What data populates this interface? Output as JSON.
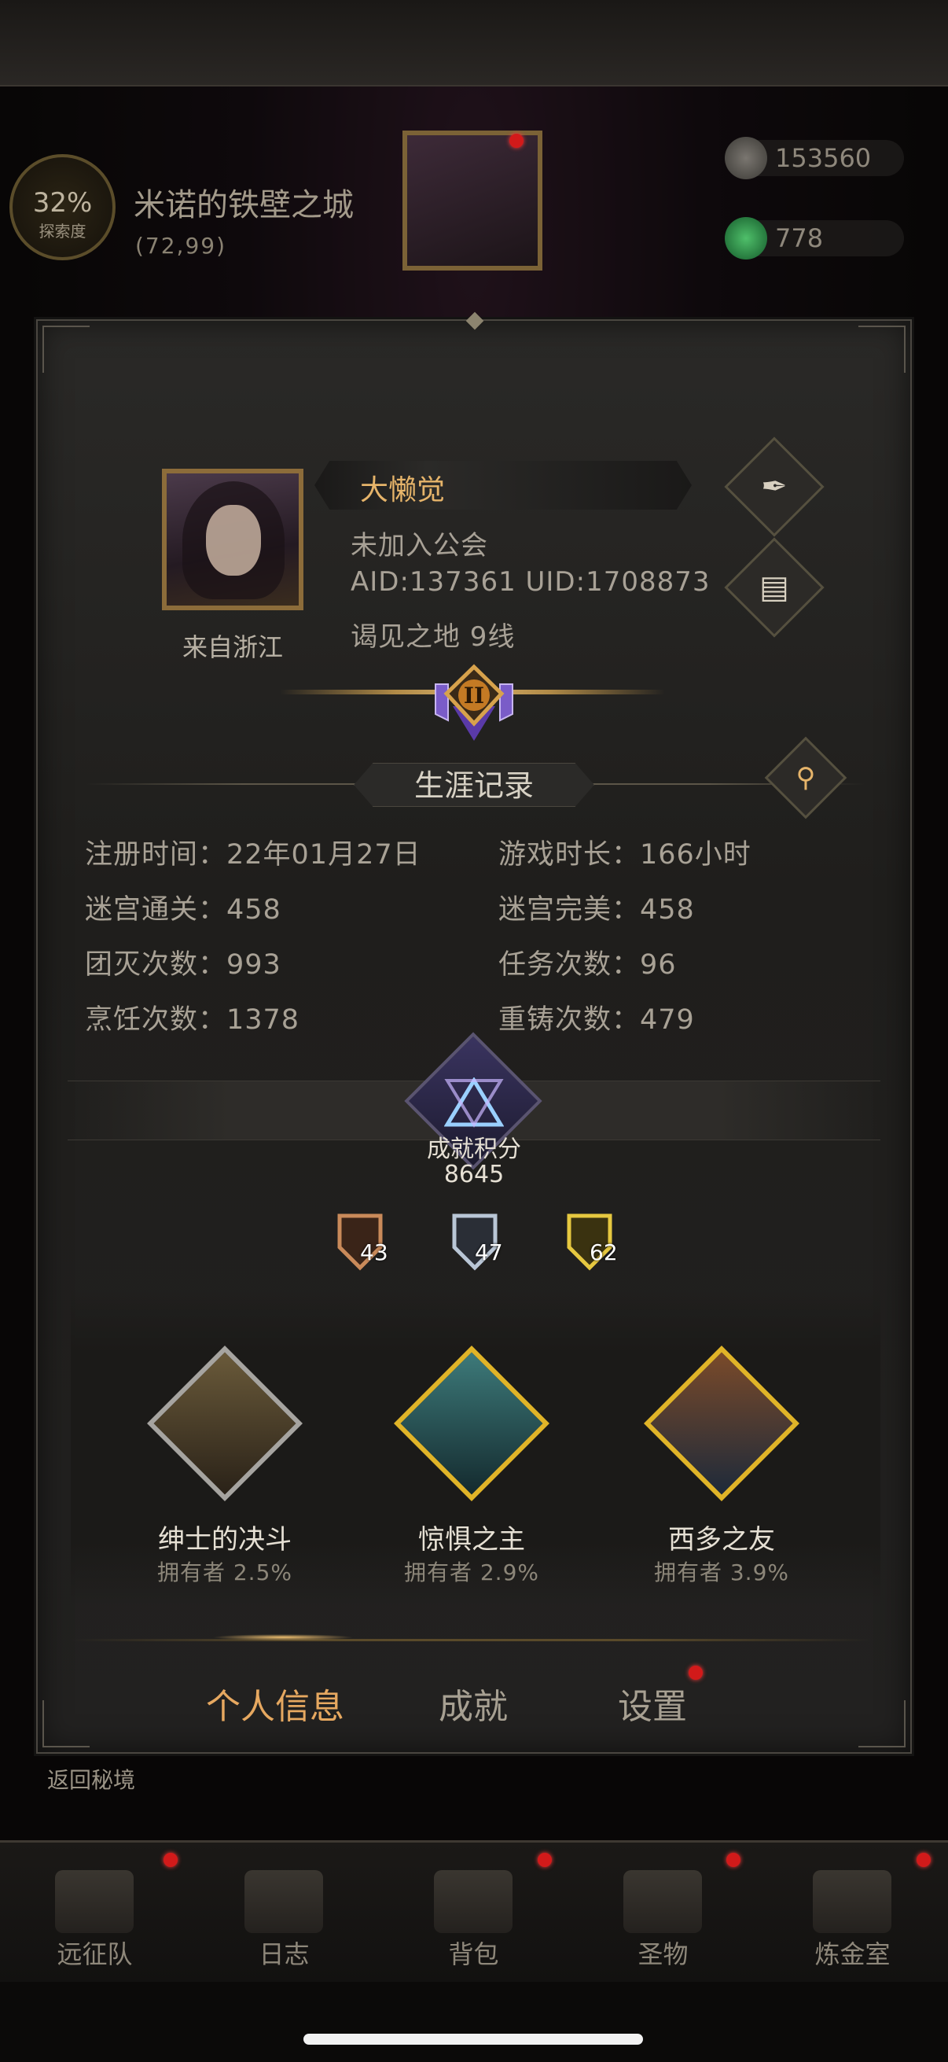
{
  "header": {
    "map_percent": "32%",
    "map_label": "探索度",
    "location": "米诺的铁壁之城",
    "coords": "(72,99)",
    "resources": [
      {
        "icon": "ore-stone-icon",
        "value": "153560"
      },
      {
        "icon": "green-gem-icon",
        "value": "778"
      }
    ]
  },
  "profile": {
    "name": "大懒觉",
    "guild": "未加入公会",
    "ids": "AID:137361 UID:1708873",
    "server": "谒见之地  9线",
    "from": "来自浙江",
    "rank_numeral": "II",
    "edit_icon": "feather-quill-icon",
    "log_icon": "document-icon"
  },
  "career": {
    "title": "生涯记录",
    "stats": [
      {
        "label": "注册时间：22年01月27日"
      },
      {
        "label": "游戏时长：166小时"
      },
      {
        "label": "迷宫通关：458"
      },
      {
        "label": "迷宫完美：458"
      },
      {
        "label": "团灭次数：993"
      },
      {
        "label": "任务次数：96"
      },
      {
        "label": "烹饪次数：1378"
      },
      {
        "label": "重铸次数：479"
      }
    ]
  },
  "achievement": {
    "label": "成就积分",
    "score": "8645",
    "medals": [
      {
        "tier": "bronze",
        "count": "43"
      },
      {
        "tier": "silver",
        "count": "47"
      },
      {
        "tier": "gold",
        "count": "62"
      }
    ],
    "featured": [
      {
        "title": "绅士的决斗",
        "owners": "拥有者  2.5%",
        "frame": "silver"
      },
      {
        "title": "惊惧之主",
        "owners": "拥有者  2.9%",
        "frame": "gold"
      },
      {
        "title": "西多之友",
        "owners": "拥有者  3.9%",
        "frame": "gold"
      }
    ]
  },
  "tabs": [
    {
      "label": "个人信息",
      "active": true
    },
    {
      "label": "成就",
      "active": false
    },
    {
      "label": "设置",
      "active": false,
      "badge": true
    }
  ],
  "back_label": "返回秘境",
  "bottom_nav": [
    {
      "label": "远征队",
      "icon": "helmet-icon",
      "badge": true
    },
    {
      "label": "日志",
      "icon": "scroll-icon",
      "badge": false
    },
    {
      "label": "背包",
      "icon": "backpack-icon",
      "badge": true
    },
    {
      "label": "圣物",
      "icon": "brazier-icon",
      "badge": true
    },
    {
      "label": "炼金室",
      "icon": "alchemy-icon",
      "badge": true
    }
  ],
  "colors": {
    "accent_gold": "#e6b46a",
    "badge_red": "#d21a1a",
    "panel_bg": "#22211f"
  }
}
